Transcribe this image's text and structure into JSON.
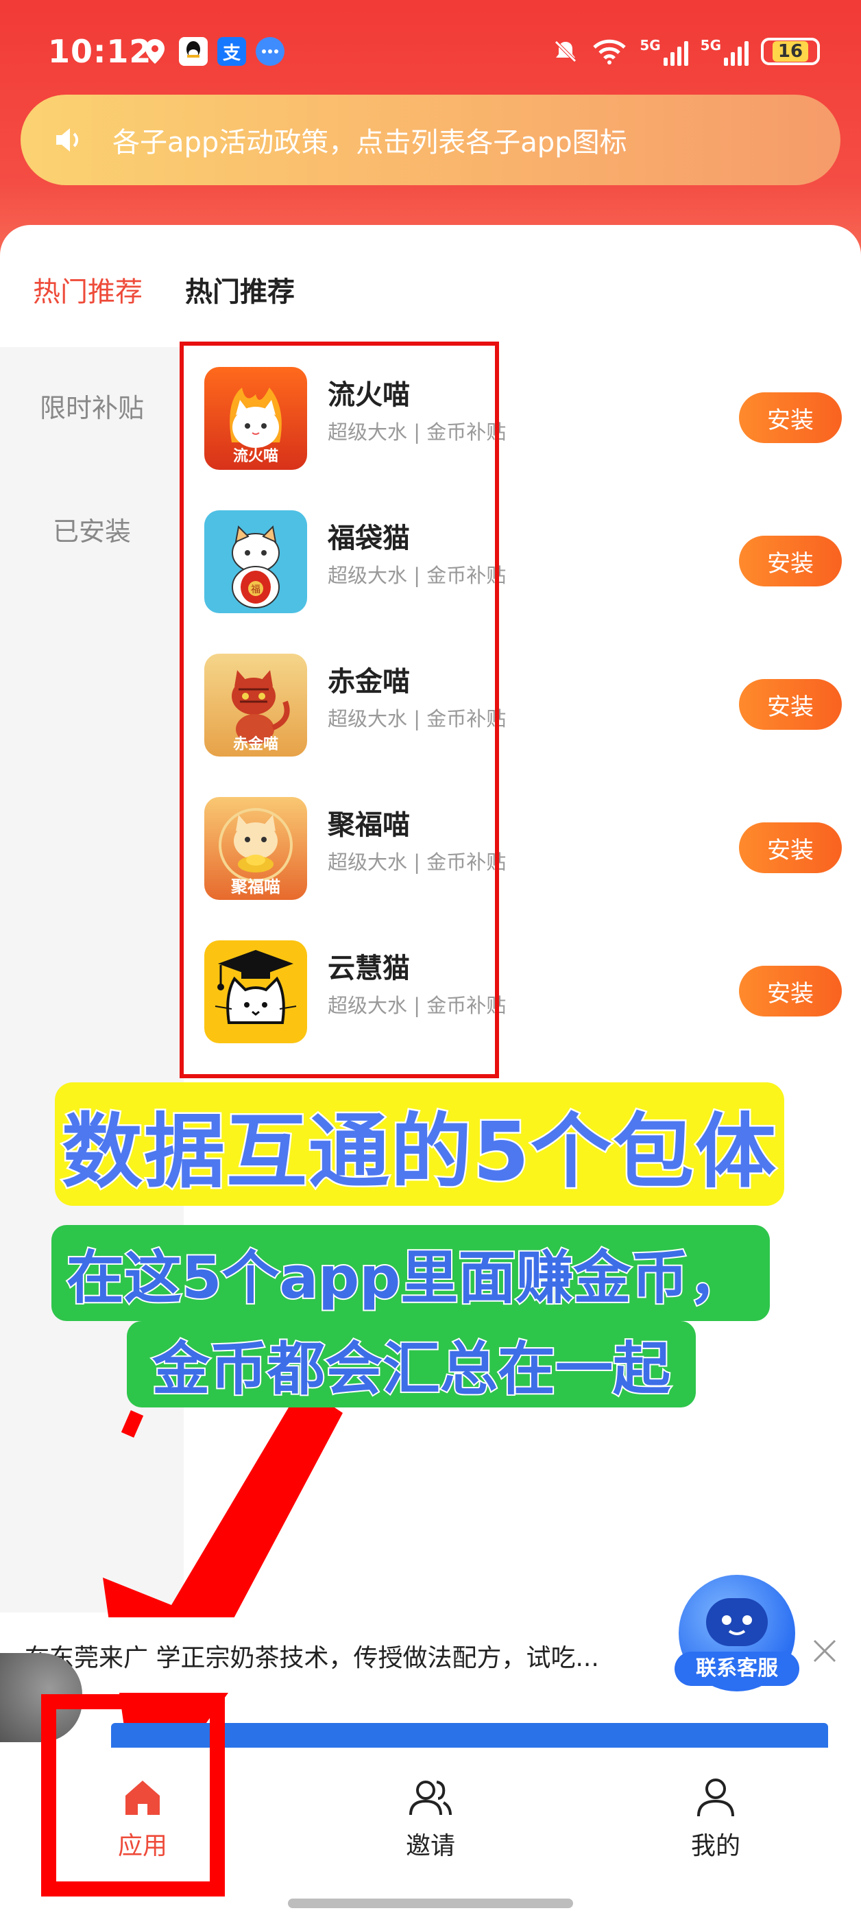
{
  "status_bar": {
    "time": "10:12",
    "network_label": "5G",
    "battery": "16"
  },
  "notice": {
    "text": "各子app活动政策，点击列表各子app图标"
  },
  "tabs": [
    {
      "label": "热门推荐"
    },
    {
      "label": "热门推荐"
    }
  ],
  "sidebar": {
    "items": [
      {
        "label": "限时补贴"
      },
      {
        "label": "已安装"
      }
    ]
  },
  "apps": [
    {
      "name": "流火喵",
      "desc": "超级大水 | 金币补贴",
      "button": "安装",
      "icon_label": "流火喵",
      "icon": "cat-fire-icon"
    },
    {
      "name": "福袋猫",
      "desc": "超级大水 | 金币补贴",
      "button": "安装",
      "icon_label": "",
      "icon": "cat-lucky-bag-icon"
    },
    {
      "name": "赤金喵",
      "desc": "超级大水 | 金币补贴",
      "button": "安装",
      "icon_label": "赤金喵",
      "icon": "cat-red-gold-icon"
    },
    {
      "name": "聚福喵",
      "desc": "超级大水 | 金币补贴",
      "button": "安装",
      "icon_label": "聚福喵",
      "icon": "cat-gold-ingot-icon"
    },
    {
      "name": "云慧猫",
      "desc": "超级大水 | 金币补贴",
      "button": "安装",
      "icon_label": "",
      "icon": "cat-graduate-icon"
    }
  ],
  "captions": {
    "line1": "数据互通的5个包体",
    "line2": "在这5个app里面赚金币，",
    "line3": "金币都会汇总在一起"
  },
  "marquee": {
    "text": "在东莞来广     学正宗奶茶技术，传授做法配方，试吃..."
  },
  "customer_service": {
    "label": "联系客服"
  },
  "bottom_nav": [
    {
      "label": "应用",
      "active": true
    },
    {
      "label": "邀请",
      "active": false
    },
    {
      "label": "我的",
      "active": false
    }
  ],
  "colors": {
    "header_red": "#f23a36",
    "accent_orange": "#f96320",
    "tab_active": "#ee4b3a",
    "annotation_red": "#e80f0f",
    "caption_yellow": "#fbf51b",
    "caption_green": "#2ec54b"
  }
}
